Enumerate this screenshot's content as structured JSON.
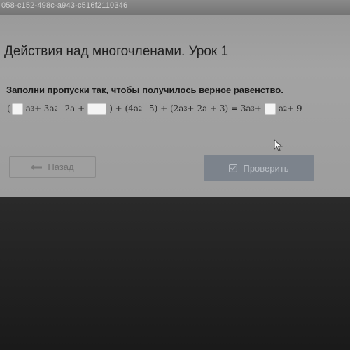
{
  "tab": {
    "id_text": "058-c152-498c-a943-c516f2110346"
  },
  "lesson": {
    "title": "Действия над многочленами. Урок 1"
  },
  "task": {
    "instruction": "Заполни пропуски так, чтобы получилось верное равенство."
  },
  "equation": {
    "t_open": "(",
    "t_a3": "a",
    "t_exp3a": "3",
    "t_p1": " + 3a",
    "t_exp2a": "2",
    "t_p2": " – 2a +",
    "t_close": ") + (4a",
    "t_exp2b": "2",
    "t_p3": " – 5) + (2a",
    "t_exp3b": "3",
    "t_p4": " + 2a + 3) = 3a",
    "t_exp3c": "3",
    "t_p5": " +",
    "t_a2": "a",
    "t_exp2c": "2",
    "t_p6": " + 9"
  },
  "buttons": {
    "back_label": "Назад",
    "check_label": "Проверить"
  },
  "icons": {
    "back": "arrow-left-icon",
    "check": "checkbox-icon",
    "cursor": "mouse-pointer-icon"
  }
}
